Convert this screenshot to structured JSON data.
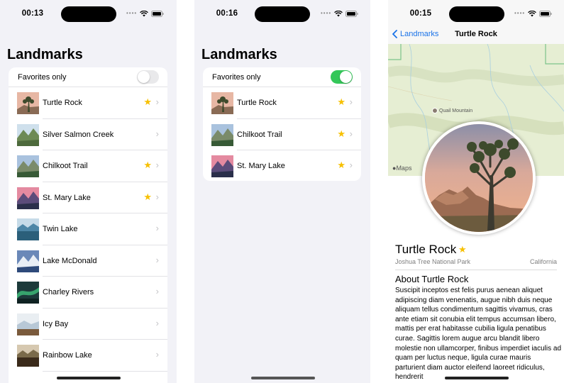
{
  "colors": {
    "accent": "#1a73e8",
    "toggle_on": "#34c759",
    "star": "#f7c000"
  },
  "screen1": {
    "time": "00:13",
    "title": "Landmarks",
    "favorites_label": "Favorites only",
    "favorites_on": false,
    "items": [
      {
        "name": "Turtle Rock",
        "favorite": true
      },
      {
        "name": "Silver Salmon Creek",
        "favorite": false
      },
      {
        "name": "Chilkoot Trail",
        "favorite": true
      },
      {
        "name": "St. Mary Lake",
        "favorite": true
      },
      {
        "name": "Twin Lake",
        "favorite": false
      },
      {
        "name": "Lake McDonald",
        "favorite": false
      },
      {
        "name": "Charley Rivers",
        "favorite": false
      },
      {
        "name": "Icy Bay",
        "favorite": false
      },
      {
        "name": "Rainbow Lake",
        "favorite": false
      }
    ]
  },
  "screen2": {
    "time": "00:16",
    "title": "Landmarks",
    "favorites_label": "Favorites only",
    "favorites_on": true,
    "items": [
      {
        "name": "Turtle Rock",
        "favorite": true
      },
      {
        "name": "Chilkoot Trail",
        "favorite": true
      },
      {
        "name": "St. Mary Lake",
        "favorite": true
      }
    ]
  },
  "screen3": {
    "time": "00:15",
    "back_label": "Landmarks",
    "nav_title": "Turtle Rock",
    "map_poi": "Quail Mountain",
    "maps_logo": "Maps",
    "title": "Turtle Rock",
    "favorite": true,
    "park": "Joshua Tree National Park",
    "state": "California",
    "about_heading": "About Turtle Rock",
    "description": "Suscipit inceptos est felis purus aenean aliquet adipiscing diam venenatis, augue nibh duis neque aliquam tellus condimentum sagittis vivamus, cras ante etiam sit conubia elit tempus accumsan libero, mattis per erat habitasse cubilia ligula penatibus curae. Sagittis lorem augue arcu blandit libero molestie non ullamcorper, finibus imperdiet iaculis ad quam per luctus neque, ligula curae mauris parturient diam auctor eleifend laoreet ridiculus, hendrerit"
  }
}
